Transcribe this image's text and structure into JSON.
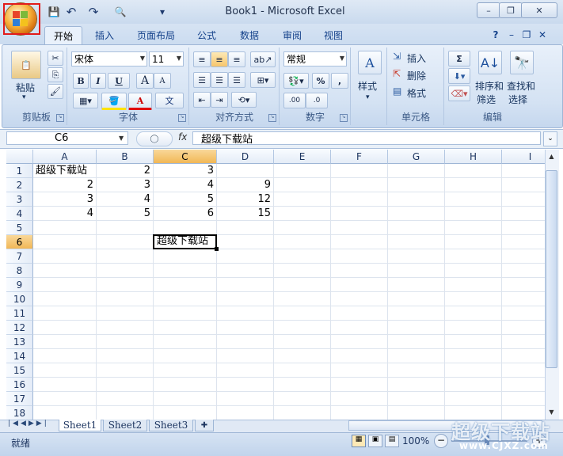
{
  "window": {
    "title": "Book1 - Microsoft Excel"
  },
  "qat": {
    "save": "💾",
    "undo": "↶",
    "redo": "↷",
    "preview": "🔍",
    "customize": "▾"
  },
  "window_controls": {
    "minimize": "–",
    "restore": "❐",
    "close": "✕"
  },
  "tabs": [
    "开始",
    "插入",
    "页面布局",
    "公式",
    "数据",
    "审阅",
    "视图"
  ],
  "ribbon_right": {
    "help": "?",
    "min": "–",
    "restore": "❐",
    "close": "✕"
  },
  "groups": {
    "clipboard": {
      "label": "剪贴板",
      "paste": "粘贴"
    },
    "font": {
      "label": "字体",
      "font_name": "宋体",
      "font_size": "11",
      "bold": "B",
      "italic": "I",
      "underline": "U",
      "grow": "A",
      "shrink": "A",
      "font_color": "A",
      "phonetic": "文"
    },
    "alignment": {
      "label": "对齐方式"
    },
    "number": {
      "label": "数字",
      "format": "常规",
      "percent": "%",
      "comma": ",",
      "inc_decimal": ".00",
      "dec_decimal": ".0"
    },
    "styles": {
      "label": "样式"
    },
    "cells": {
      "label": "单元格",
      "insert": "插入",
      "delete": "删除",
      "format": "格式"
    },
    "editing": {
      "label": "编辑",
      "sum": "Σ",
      "sort_filter": "排序和\n筛选",
      "find_select": "查找和\n选择",
      "sort_line1": "排序和",
      "sort_line2": "筛选",
      "find_line1": "查找和",
      "find_line2": "选择"
    }
  },
  "formula_bar": {
    "name_box": "C6",
    "fx": "fx",
    "content": "超级下载站"
  },
  "columns": [
    "A",
    "B",
    "C",
    "D",
    "E",
    "F",
    "G",
    "H",
    "I"
  ],
  "rows": [
    "1",
    "2",
    "3",
    "4",
    "5",
    "6",
    "7",
    "8",
    "9",
    "10",
    "11",
    "12",
    "13",
    "14",
    "15",
    "16",
    "17",
    "18"
  ],
  "cells": {
    "A1": "超级下载站",
    "B1": "2",
    "C1": "3",
    "A2": "2",
    "B2": "3",
    "C2": "4",
    "D2": "9",
    "A3": "3",
    "B3": "4",
    "C3": "5",
    "D3": "12",
    "A4": "4",
    "B4": "5",
    "C4": "6",
    "D4": "15",
    "C6": "超级下载站"
  },
  "active_cell": "C6",
  "sheets": [
    "Sheet1",
    "Sheet2",
    "Sheet3"
  ],
  "active_sheet": "Sheet1",
  "status": {
    "mode": "就绪",
    "zoom": "100%",
    "zoom_out": "−",
    "zoom_in": "+"
  },
  "watermark": {
    "text": "超级下载站",
    "url": "www.CJXZ.com"
  }
}
